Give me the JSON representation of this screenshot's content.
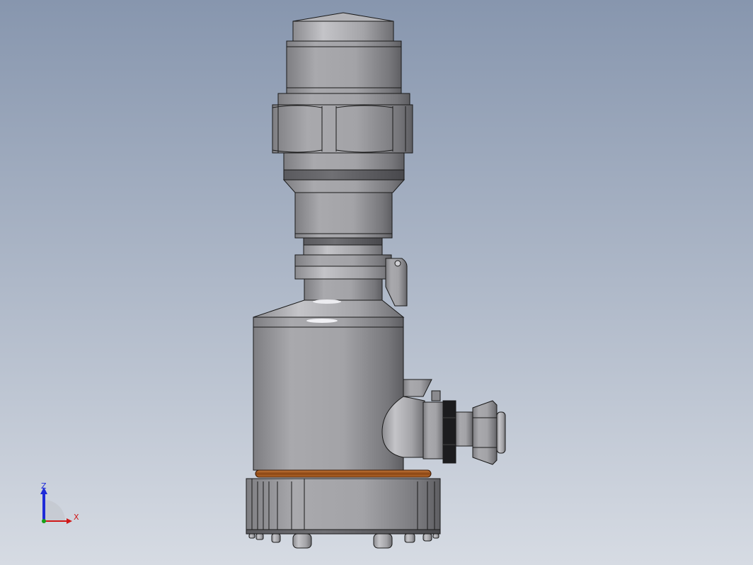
{
  "view": {
    "background_top": "#8796ae",
    "background_bottom": "#d6dbe3",
    "part_color": "#9a9a9e",
    "seal_color": "#a0581e"
  },
  "triad": {
    "z_label": "Z",
    "x_label": "X",
    "z_color": "#1e2bd8",
    "x_color": "#d01818",
    "y_color": "#18a018"
  }
}
